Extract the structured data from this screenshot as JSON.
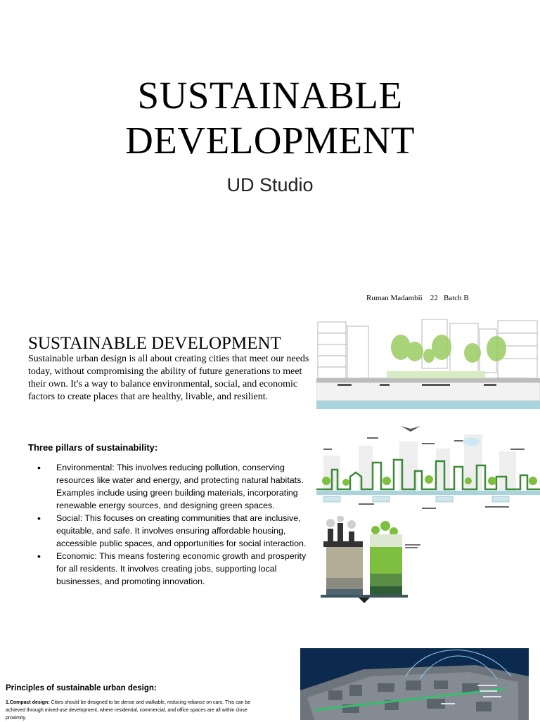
{
  "slide1": {
    "title_line1": "SUSTAINABLE",
    "title_line2": "DEVELOPMENT",
    "subtitle": "UD Studio",
    "author": "Ruman Madambii    22   Batch B"
  },
  "slide2": {
    "heading": "SUSTAINABLE DEVELOPMENT",
    "intro": "Sustainable urban design is all about creating cities that meet our needs today, without compromising the ability of future generations to meet their own. It's a way to balance environmental, social, and economic factors to create places that are healthy, livable, and resilient.",
    "pillars_heading": "Three pillars of sustainability:",
    "pillars": [
      "Environmental: This involves reducing pollution, conserving resources like water and energy, and protecting natural habitats. Examples include using green building materials, incorporating renewable energy sources, and designing green spaces.",
      "Social: This focuses on creating communities that are inclusive, equitable, and safe. It involves ensuring affordable housing, accessible public spaces, and opportunities for social interaction.",
      "Economic: This means fostering economic growth and prosperity for all residents. It involves creating jobs, supporting local businesses, and promoting innovation."
    ]
  },
  "slide3": {
    "heading": "Principles of sustainable urban design:",
    "item1_label": "1.Compact design:",
    "item1_text": " Cities should be designed to be dense and walkable, reducing reliance on cars. This can be achieved through mixed-use development, where residential, commercial, and office spaces are all within close proximity."
  },
  "colors": {
    "green": "#7fbf3f",
    "water": "#a9d4de",
    "night_blue": "#0c2a4e"
  }
}
